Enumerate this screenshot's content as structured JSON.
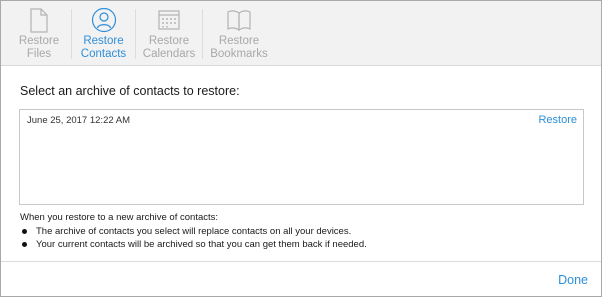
{
  "toolbar": {
    "tabs": [
      {
        "label_line1": "Restore",
        "label_line2": "Files",
        "icon": "file-icon",
        "active": false
      },
      {
        "label_line1": "Restore",
        "label_line2": "Contacts",
        "icon": "contacts-icon",
        "active": true
      },
      {
        "label_line1": "Restore",
        "label_line2": "Calendars",
        "icon": "calendar-icon",
        "active": false
      },
      {
        "label_line1": "Restore",
        "label_line2": "Bookmarks",
        "icon": "bookmarks-icon",
        "active": false
      }
    ]
  },
  "main": {
    "heading": "Select an archive of contacts to restore:",
    "archives": [
      {
        "date": "June 25, 2017 12:22 AM",
        "action": "Restore"
      }
    ],
    "note_title": "When you restore to a new archive of contacts:",
    "bullets": [
      "The archive of contacts you select will replace contacts on all your devices.",
      "Your current contacts will be archived so that you can get them back if needed."
    ]
  },
  "footer": {
    "done_label": "Done"
  },
  "colors": {
    "accent": "#2e8fd9",
    "inactive_text": "#a8a8a8",
    "toolbar_bg": "#f2f2f2"
  }
}
